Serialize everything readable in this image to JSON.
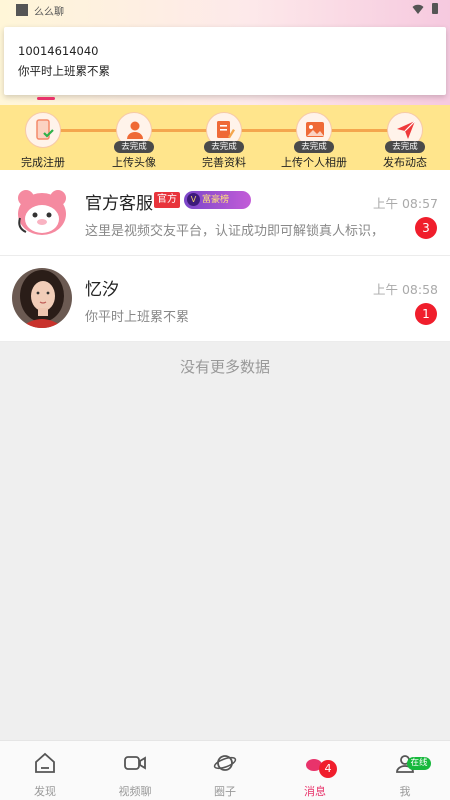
{
  "status_bar": {
    "app_name": "么么聊"
  },
  "notification": {
    "title": "10014614040",
    "body": "你平时上班累不累"
  },
  "steps": [
    {
      "label": "完成注册",
      "todo": "",
      "icon": "phone-check-icon"
    },
    {
      "label": "上传头像",
      "todo": "去完成",
      "icon": "avatar-upload-icon"
    },
    {
      "label": "完善资料",
      "todo": "去完成",
      "icon": "profile-edit-icon"
    },
    {
      "label": "上传个人相册",
      "todo": "去完成",
      "icon": "photo-album-icon"
    },
    {
      "label": "发布动态",
      "todo": "去完成",
      "icon": "send-icon"
    }
  ],
  "messages": [
    {
      "name": "官方客服",
      "tag_official": "官方",
      "tag_vip": "富豪榜",
      "time": "上午 08:57",
      "preview": "这里是视频交友平台，认证成功即可解锁真人标识，",
      "unread": "3"
    },
    {
      "name": "忆汐",
      "time": "上午 08:58",
      "preview": "你平时上班累不累",
      "unread": "1"
    }
  ],
  "no_more_text": "没有更多数据",
  "bottom_nav": {
    "items": [
      {
        "label": "发现",
        "icon": "home-icon"
      },
      {
        "label": "视频聊",
        "icon": "video-icon"
      },
      {
        "label": "圈子",
        "icon": "planet-icon"
      },
      {
        "label": "消息",
        "icon": "message-icon",
        "badge": "4",
        "active": true
      },
      {
        "label": "我",
        "icon": "user-icon",
        "status": "在线"
      }
    ]
  },
  "colors": {
    "accent": "#e8336b",
    "steps_bg": "#ffe58c",
    "badge": "#f01e2c",
    "online": "#17b83c"
  }
}
